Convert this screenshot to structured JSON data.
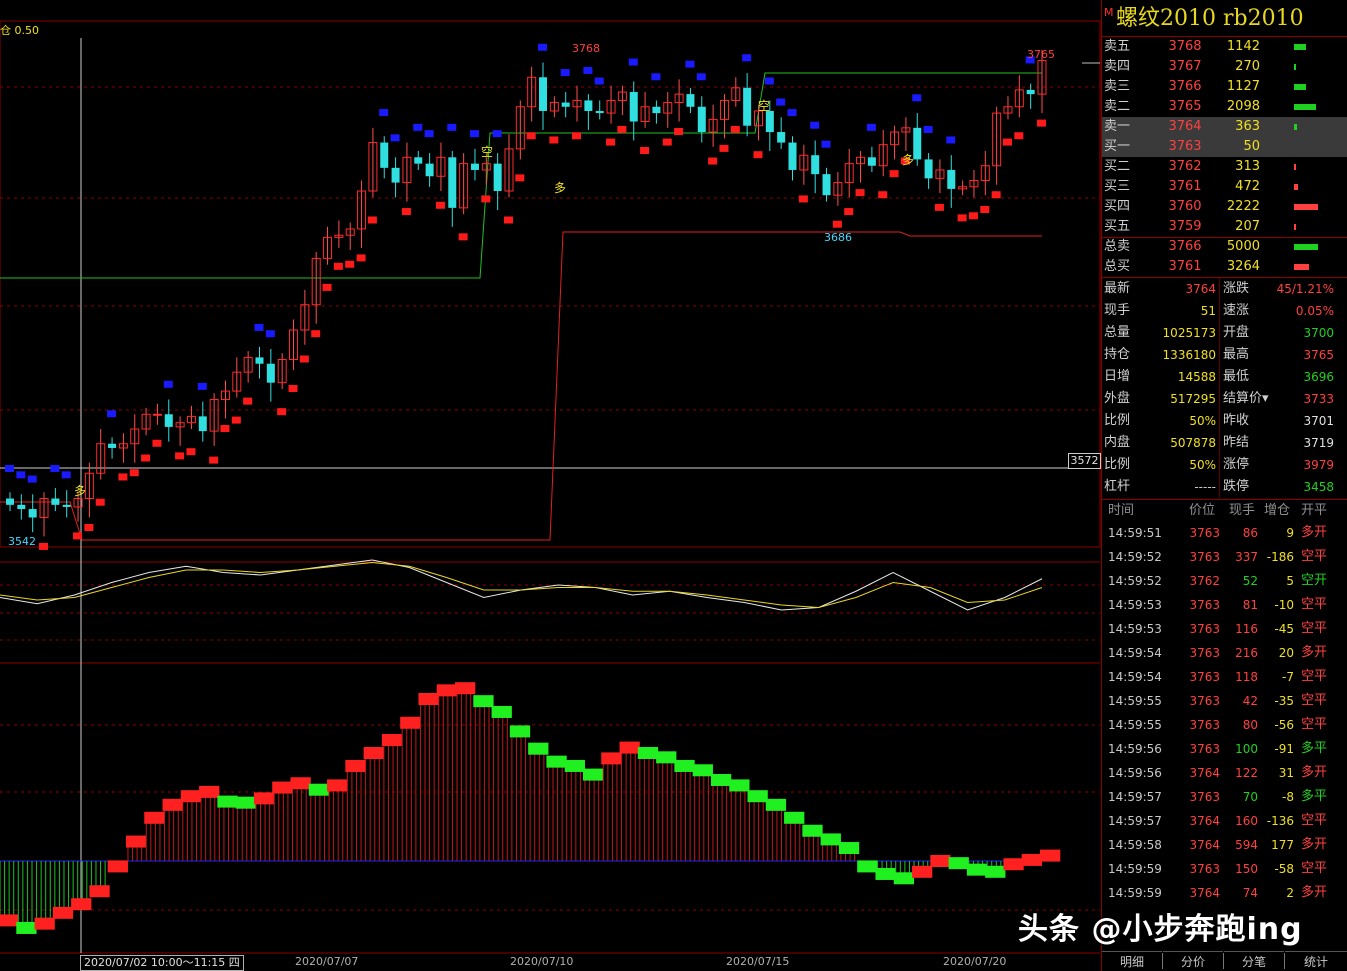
{
  "chart": {
    "position_label": "仓 0.50",
    "price_tag": "3572",
    "date_range": "2020/07/02 10:00～11:15 四",
    "dates": [
      "2020/07/07",
      "2020/07/10",
      "2020/07/15",
      "2020/07/20"
    ],
    "marks": {
      "high_1": "3768",
      "high_2": "3765",
      "low_1": "3686",
      "low_2": "3542"
    },
    "signals": {
      "long_1": "多",
      "short_1": "空",
      "long_2": "多",
      "short_2": "空",
      "long_3": "多"
    }
  },
  "chart_data": {
    "type": "candlestick",
    "title": "螺纹2010 rb2010",
    "x_ticks": [
      "2020/07/07",
      "2020/07/10",
      "2020/07/15",
      "2020/07/20"
    ],
    "price_labels": {
      "high": 3768,
      "last_high": 3765,
      "low": 3542,
      "swing_low": 3686,
      "guide": 3572
    },
    "series": [
      {
        "name": "close",
        "values": [
          3553,
          3551,
          3547,
          3556,
          3553,
          3552,
          3556,
          3568,
          3582,
          3580,
          3582,
          3589,
          3596,
          3596,
          3590,
          3592,
          3595,
          3588,
          3603,
          3607,
          3616,
          3623,
          3620,
          3611,
          3622,
          3636,
          3648,
          3670,
          3680,
          3681,
          3684,
          3702,
          3725,
          3713,
          3706,
          3718,
          3715,
          3709,
          3718,
          3694,
          3715,
          3712,
          3715,
          3702,
          3722,
          3742,
          3756,
          3740,
          3744,
          3742,
          3745,
          3740,
          3739,
          3745,
          3749,
          3735,
          3742,
          3739,
          3744,
          3748,
          3742,
          3730,
          3736,
          3745,
          3751,
          3733,
          3740,
          3730,
          3725,
          3712,
          3719,
          3710,
          3700,
          3706,
          3715,
          3718,
          3714,
          3724,
          3730,
          3732,
          3717,
          3708,
          3712,
          3703,
          3704,
          3707,
          3714,
          3739,
          3742,
          3750,
          3748,
          3764
        ]
      },
      {
        "name": "macd",
        "values": [
          -55,
          -62,
          -58,
          -48,
          -40,
          -28,
          -5,
          18,
          40,
          52,
          60,
          64,
          55,
          54,
          58,
          68,
          72,
          66,
          70,
          88,
          100,
          112,
          128,
          150,
          158,
          160,
          148,
          138,
          120,
          104,
          92,
          88,
          80,
          95,
          105,
          100,
          96,
          88,
          84,
          75,
          70,
          60,
          52,
          40,
          28,
          20,
          12,
          -5,
          -12,
          -16,
          -10,
          0,
          -2,
          -8,
          -10,
          -3,
          1,
          5
        ]
      },
      {
        "name": "K",
        "values": [
          0.5,
          0.45,
          0.52,
          0.62,
          0.7,
          0.75,
          0.7,
          0.68,
          0.72,
          0.76,
          0.8,
          0.74,
          0.62,
          0.5,
          0.56,
          0.6,
          0.58,
          0.52,
          0.55,
          0.5,
          0.46,
          0.4,
          0.42,
          0.55,
          0.7,
          0.55,
          0.4,
          0.5,
          0.65
        ]
      },
      {
        "name": "D",
        "values": [
          0.52,
          0.48,
          0.5,
          0.58,
          0.66,
          0.72,
          0.72,
          0.7,
          0.72,
          0.75,
          0.78,
          0.75,
          0.66,
          0.56,
          0.56,
          0.58,
          0.58,
          0.55,
          0.55,
          0.52,
          0.48,
          0.44,
          0.42,
          0.5,
          0.62,
          0.58,
          0.46,
          0.48,
          0.58
        ]
      }
    ]
  },
  "contract": {
    "mark": "M",
    "title": "螺纹2010  rb2010"
  },
  "orderbook": [
    {
      "label": "卖五",
      "price": "3768",
      "vol": "1142",
      "side": "sell",
      "bar": 12
    },
    {
      "label": "卖四",
      "price": "3767",
      "vol": "270",
      "side": "sell",
      "bar": 2
    },
    {
      "label": "卖三",
      "price": "3766",
      "vol": "1127",
      "side": "sell",
      "bar": 12
    },
    {
      "label": "卖二",
      "price": "3765",
      "vol": "2098",
      "side": "sell",
      "bar": 22
    },
    {
      "label": "卖一",
      "price": "3764",
      "vol": "363",
      "side": "sell",
      "bar": 3
    },
    {
      "label": "买一",
      "price": "3763",
      "vol": "50",
      "side": "buy",
      "bar": 0
    },
    {
      "label": "买二",
      "price": "3762",
      "vol": "313",
      "side": "buy",
      "bar": 2
    },
    {
      "label": "买三",
      "price": "3761",
      "vol": "472",
      "side": "buy",
      "bar": 4
    },
    {
      "label": "买四",
      "price": "3760",
      "vol": "2222",
      "side": "buy",
      "bar": 24
    },
    {
      "label": "买五",
      "price": "3759",
      "vol": "207",
      "side": "buy",
      "bar": 2
    }
  ],
  "totals": [
    {
      "label": "总卖",
      "price": "3766",
      "vol": "5000",
      "color": "#20d020",
      "bar": 24
    },
    {
      "label": "总买",
      "price": "3761",
      "vol": "3264",
      "color": "#ff4040",
      "bar": 15
    }
  ],
  "stats": [
    {
      "l1": "最新",
      "v1": "3764",
      "c1": "#ff4040",
      "l2": "涨跌",
      "v2": "45/1.21%",
      "c2": "#ff4040"
    },
    {
      "l1": "现手",
      "v1": "51",
      "c1": "#f0e020",
      "l2": "速涨",
      "v2": "0.05%",
      "c2": "#ff4040"
    },
    {
      "l1": "总量",
      "v1": "1025173",
      "c1": "#f0e020",
      "l2": "开盘",
      "v2": "3700",
      "c2": "#20d020"
    },
    {
      "l1": "持仓",
      "v1": "1336180",
      "c1": "#f0e020",
      "l2": "最高",
      "v2": "3765",
      "c2": "#ff4040"
    },
    {
      "l1": "日增",
      "v1": "14588",
      "c1": "#f0e020",
      "l2": "最低",
      "v2": "3696",
      "c2": "#20d020"
    },
    {
      "l1": "外盘",
      "v1": "517295",
      "c1": "#f0e020",
      "l2": "结算价▾",
      "v2": "3733",
      "c2": "#ff4040"
    },
    {
      "l1": "比例",
      "v1": "50%",
      "c1": "#f0e020",
      "l2": "昨收",
      "v2": "3701",
      "c2": "#e0e0e0"
    },
    {
      "l1": "内盘",
      "v1": "507878",
      "c1": "#f0e020",
      "l2": "昨结",
      "v2": "3719",
      "c2": "#e0e0e0"
    },
    {
      "l1": "比例",
      "v1": "50%",
      "c1": "#f0e020",
      "l2": "涨停",
      "v2": "3979",
      "c2": "#ff4040"
    },
    {
      "l1": "杠杆",
      "v1": "-----",
      "c1": "#c8c8c8",
      "l2": "跌停",
      "v2": "3458",
      "c2": "#20d020"
    }
  ],
  "ticks_header": {
    "time": "时间",
    "price": "价位",
    "vol": "现手",
    "delta": "增仓",
    "kind": "开平"
  },
  "ticks": [
    {
      "time": "14:59:51",
      "price": "3763",
      "vol": "86",
      "delta": "9",
      "kind": "多开",
      "pc": "#ff4040",
      "vc": "#ff4040",
      "kc": "#ff4040"
    },
    {
      "time": "14:59:52",
      "price": "3763",
      "vol": "337",
      "delta": "-186",
      "kind": "空平",
      "pc": "#ff4040",
      "vc": "#ff4040",
      "kc": "#ff4040"
    },
    {
      "time": "14:59:52",
      "price": "3762",
      "vol": "52",
      "delta": "5",
      "kind": "空开",
      "pc": "#ff4040",
      "vc": "#20d020",
      "kc": "#20d020"
    },
    {
      "time": "14:59:53",
      "price": "3763",
      "vol": "81",
      "delta": "-10",
      "kind": "空平",
      "pc": "#ff4040",
      "vc": "#ff4040",
      "kc": "#ff4040"
    },
    {
      "time": "14:59:53",
      "price": "3763",
      "vol": "116",
      "delta": "-45",
      "kind": "空平",
      "pc": "#ff4040",
      "vc": "#ff4040",
      "kc": "#ff4040"
    },
    {
      "time": "14:59:54",
      "price": "3763",
      "vol": "216",
      "delta": "20",
      "kind": "多开",
      "pc": "#ff4040",
      "vc": "#ff4040",
      "kc": "#ff4040"
    },
    {
      "time": "14:59:54",
      "price": "3763",
      "vol": "118",
      "delta": "-7",
      "kind": "空平",
      "pc": "#ff4040",
      "vc": "#ff4040",
      "kc": "#ff4040"
    },
    {
      "time": "14:59:55",
      "price": "3763",
      "vol": "42",
      "delta": "-35",
      "kind": "空平",
      "pc": "#ff4040",
      "vc": "#ff4040",
      "kc": "#ff4040"
    },
    {
      "time": "14:59:55",
      "price": "3763",
      "vol": "80",
      "delta": "-56",
      "kind": "空平",
      "pc": "#ff4040",
      "vc": "#ff4040",
      "kc": "#ff4040"
    },
    {
      "time": "14:59:56",
      "price": "3763",
      "vol": "100",
      "delta": "-91",
      "kind": "多平",
      "pc": "#ff4040",
      "vc": "#20d020",
      "kc": "#20d020"
    },
    {
      "time": "14:59:56",
      "price": "3764",
      "vol": "122",
      "delta": "31",
      "kind": "多开",
      "pc": "#ff4040",
      "vc": "#ff4040",
      "kc": "#ff4040"
    },
    {
      "time": "14:59:57",
      "price": "3763",
      "vol": "70",
      "delta": "-8",
      "kind": "多平",
      "pc": "#ff4040",
      "vc": "#20d020",
      "kc": "#20d020"
    },
    {
      "time": "14:59:57",
      "price": "3764",
      "vol": "160",
      "delta": "-136",
      "kind": "空平",
      "pc": "#ff4040",
      "vc": "#ff4040",
      "kc": "#ff4040"
    },
    {
      "time": "14:59:58",
      "price": "3764",
      "vol": "594",
      "delta": "177",
      "kind": "多开",
      "pc": "#ff4040",
      "vc": "#ff4040",
      "kc": "#ff4040"
    },
    {
      "time": "14:59:59",
      "price": "3763",
      "vol": "150",
      "delta": "-58",
      "kind": "空平",
      "pc": "#ff4040",
      "vc": "#ff4040",
      "kc": "#ff4040"
    },
    {
      "time": "14:59:59",
      "price": "3764",
      "vol": "74",
      "delta": "2",
      "kind": "多开",
      "pc": "#ff4040",
      "vc": "#ff4040",
      "kc": "#ff4040"
    }
  ],
  "tabs": [
    "明细",
    "分价",
    "分笔",
    "统计"
  ],
  "watermark": "头条 @小步奔跑ing"
}
